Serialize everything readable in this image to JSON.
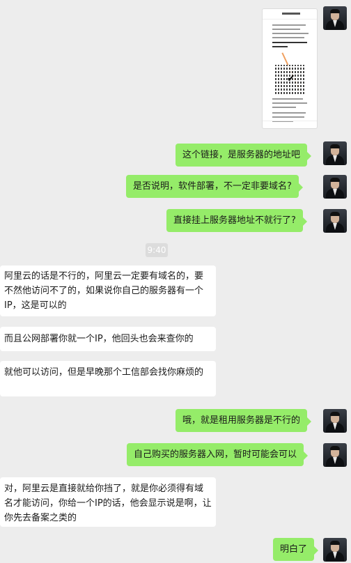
{
  "chat": {
    "time_separator": "9:40",
    "messages": [
      {
        "side": "me",
        "text": "这个链接，是服务器的地址吧"
      },
      {
        "side": "me",
        "text": "是否说明，软件部署，不一定非要域名?"
      },
      {
        "side": "me",
        "text": "直接挂上服务器地址不就行了?"
      },
      {
        "side": "them",
        "text": "阿里云的话是不行的，阿里云一定要有域名的，要不然他访问不了的，如果说你自己的服务器有一个IP，这是可以的"
      },
      {
        "side": "them",
        "text": "而且公网部署你就一个IP，他回头也会来查你的"
      },
      {
        "side": "them",
        "text": "就他可以访问，但是早晚那个工信部会找你麻烦的"
      },
      {
        "side": "me",
        "text": "哦，就是租用服务器是不行的"
      },
      {
        "side": "me",
        "text": "自己购买的服务器入网，暂时可能会可以"
      },
      {
        "side": "them",
        "text": "对，阿里云是直接就给你挡了，就是你必须得有域名才能访问，你给一个IP的话，他会显示说是啊，让你先去备案之类的"
      },
      {
        "side": "me",
        "text": "明白了"
      }
    ]
  },
  "colors": {
    "my_bubble": "#95ec69",
    "their_bubble": "#ffffff",
    "background": "#ededed"
  }
}
